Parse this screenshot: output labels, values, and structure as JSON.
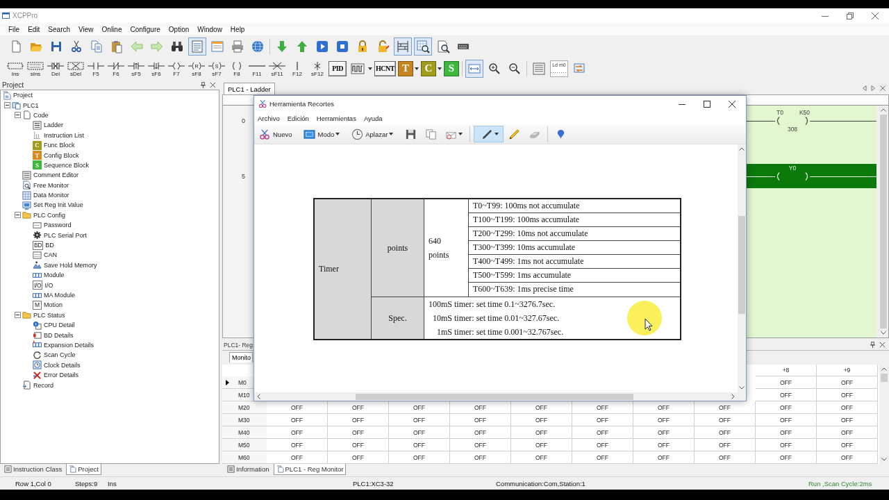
{
  "window": {
    "title": "XCPPro"
  },
  "menu": [
    "File",
    "Edit",
    "Search",
    "View",
    "Online",
    "Configure",
    "Option",
    "Window",
    "Help"
  ],
  "toolbar_main": [
    {
      "kind": "button",
      "pressed": false
    },
    {
      "kind": "button",
      "pressed": false
    },
    {
      "kind": "button",
      "pressed": false
    },
    {
      "kind": "button",
      "pressed": false
    },
    {
      "kind": "button",
      "pressed": false
    },
    {
      "kind": "button",
      "pressed": false
    },
    {
      "kind": "button",
      "pressed": false
    },
    {
      "kind": "button",
      "pressed": false
    },
    {
      "kind": "button",
      "pressed": false
    },
    {
      "kind": "button",
      "pressed": true
    },
    {
      "kind": "button",
      "pressed": false
    },
    {
      "kind": "button",
      "pressed": false
    },
    {
      "kind": "button",
      "pressed": false
    },
    {
      "kind": "separator"
    },
    {
      "kind": "button",
      "pressed": false
    },
    {
      "kind": "button",
      "pressed": false
    },
    {
      "kind": "button",
      "pressed": false
    },
    {
      "kind": "button",
      "pressed": false
    },
    {
      "kind": "button",
      "pressed": false
    },
    {
      "kind": "button",
      "pressed": false
    },
    {
      "kind": "button",
      "pressed": true
    },
    {
      "kind": "button",
      "pressed": true
    },
    {
      "kind": "button",
      "pressed": false
    },
    {
      "kind": "button",
      "pressed": false
    }
  ],
  "toolbar_ladder": [
    {
      "kind": "tool",
      "label": "Ins"
    },
    {
      "kind": "tool",
      "label": "sIns"
    },
    {
      "kind": "tool",
      "label": "Del"
    },
    {
      "kind": "tool",
      "label": "sDel"
    },
    {
      "kind": "tool",
      "label": "F5"
    },
    {
      "kind": "tool",
      "label": "F6"
    },
    {
      "kind": "tool",
      "label": "sF5"
    },
    {
      "kind": "tool",
      "label": "sF6"
    },
    {
      "kind": "tool",
      "label": "F7"
    },
    {
      "kind": "tool",
      "label": "sF8",
      "symbol": "R"
    },
    {
      "kind": "tool",
      "label": "sF7",
      "symbol": "S"
    },
    {
      "kind": "tool",
      "label": "F8"
    },
    {
      "kind": "tool",
      "label": "F11"
    },
    {
      "kind": "tool",
      "label": "sF11"
    },
    {
      "kind": "tool",
      "label": "F12"
    },
    {
      "kind": "tool",
      "label": "sF12"
    },
    {
      "kind": "text",
      "text": "PID"
    },
    {
      "kind": "icon",
      "pressed": false,
      "dropdown": true
    },
    {
      "kind": "text",
      "text": "HCNT"
    },
    {
      "kind": "letter",
      "text": "T",
      "color": "#c8841e",
      "dropdown": true
    },
    {
      "kind": "letter",
      "text": "C",
      "color": "#a19c1c",
      "dropdown": true
    },
    {
      "kind": "letter",
      "text": "S",
      "color": "#3db83d"
    },
    {
      "kind": "separator"
    },
    {
      "kind": "icon",
      "pressed": true
    },
    {
      "kind": "icon",
      "pressed": false
    },
    {
      "kind": "icon",
      "pressed": false
    },
    {
      "kind": "separator"
    },
    {
      "kind": "icon",
      "pressed": false
    },
    {
      "kind": "caption",
      "text": "Ld m0"
    },
    {
      "kind": "icon",
      "pressed": false
    }
  ],
  "project_panel": {
    "title": "Project",
    "tree": [
      {
        "label": "Project",
        "children": [
          {
            "label": "PLC1",
            "expanded": true,
            "children": [
              {
                "label": "Code",
                "expanded": true,
                "children": [
                  {
                    "label": "Ladder"
                  },
                  {
                    "label": "Instruction List"
                  },
                  {
                    "label": "Func Block",
                    "icon_text": "C",
                    "color": "#a19c1c"
                  },
                  {
                    "label": "Config Block",
                    "icon_text": "T",
                    "color": "#d98a1c"
                  },
                  {
                    "label": "Sequence Block",
                    "icon_text": "S",
                    "color": "#3db83d"
                  }
                ]
              },
              {
                "label": "Comment Editor"
              },
              {
                "label": "Free Monitor"
              },
              {
                "label": "Data Monitor"
              },
              {
                "label": "Set Reg Init Value"
              },
              {
                "label": "PLC Config",
                "expanded": true,
                "children": [
                  {
                    "label": "Password"
                  },
                  {
                    "label": "PLC Serial Port"
                  },
                  {
                    "label": "BD",
                    "icon_text": "BD"
                  },
                  {
                    "label": "CAN"
                  },
                  {
                    "label": "Save Hold Memory"
                  },
                  {
                    "label": "Module"
                  },
                  {
                    "label": "I/O",
                    "icon_text": "I/O"
                  },
                  {
                    "label": "MA Module"
                  },
                  {
                    "label": "Motion",
                    "icon_text": "M"
                  }
                ]
              },
              {
                "label": "PLC Status",
                "expanded": true,
                "children": [
                  {
                    "label": "CPU Detail"
                  },
                  {
                    "label": "BD Details"
                  },
                  {
                    "label": "Expansion Details"
                  },
                  {
                    "label": "Scan Cycle"
                  },
                  {
                    "label": "Clock Details"
                  },
                  {
                    "label": "Error Details"
                  }
                ]
              },
              {
                "label": "Record"
              }
            ]
          }
        ]
      }
    ]
  },
  "left_tabs": [
    {
      "label": "Instruction Class",
      "selected": false
    },
    {
      "label": "Project",
      "selected": true
    }
  ],
  "editor": {
    "tab": "PLC1 - Ladder",
    "rungs": [
      {
        "number": "0",
        "energized": false,
        "coil": {
          "name": "T0",
          "preset": "K50",
          "current": "308"
        }
      },
      {
        "number": "5",
        "energized": true,
        "coil": {
          "name": "Y0"
        }
      }
    ]
  },
  "reg_monitor": {
    "title": "PLC1- Reg",
    "tabs": [
      {
        "label": "Monito",
        "selected": true
      }
    ],
    "columns": [
      "+8",
      "+9"
    ],
    "rows": [
      {
        "label": "M0",
        "selected": true,
        "cells": [
          "OFF",
          "OFF"
        ]
      },
      {
        "label": "M10",
        "selected": false,
        "cells": [
          "OFF",
          "OFF"
        ]
      },
      {
        "label": "M20",
        "selected": false,
        "cells": [
          "OFF",
          "OFF",
          "OFF",
          "OFF",
          "OFF",
          "OFF",
          "OFF",
          "OFF",
          "OFF",
          "OFF"
        ]
      },
      {
        "label": "M30",
        "selected": false,
        "cells": [
          "OFF",
          "OFF",
          "OFF",
          "OFF",
          "OFF",
          "OFF",
          "OFF",
          "OFF",
          "OFF",
          "OFF"
        ]
      },
      {
        "label": "M40",
        "selected": false,
        "cells": [
          "OFF",
          "OFF",
          "OFF",
          "OFF",
          "OFF",
          "OFF",
          "OFF",
          "OFF",
          "OFF",
          "OFF"
        ]
      },
      {
        "label": "M50",
        "selected": false,
        "cells": [
          "OFF",
          "OFF",
          "OFF",
          "OFF",
          "OFF",
          "OFF",
          "OFF",
          "OFF",
          "OFF",
          "OFF"
        ]
      },
      {
        "label": "M60",
        "selected": false,
        "cells": [
          "OFF",
          "OFF",
          "OFF",
          "OFF",
          "OFF",
          "OFF",
          "OFF",
          "OFF",
          "OFF",
          "OFF"
        ]
      }
    ]
  },
  "bottom_tabs": [
    {
      "label": "Information",
      "selected": false
    },
    {
      "label": "PLC1 - Reg Monitor",
      "selected": true
    }
  ],
  "status_bar": [
    {
      "text": "Row 1,Col 0",
      "kind": "info"
    },
    {
      "text": "Steps:9",
      "kind": "info"
    },
    {
      "text": "Ins",
      "kind": "info"
    },
    {
      "text": "PLC1:XC3-32",
      "kind": "info"
    },
    {
      "text": "Communication:Com,Station:1",
      "kind": "info"
    },
    {
      "text": "Run ,Scan Cycle:2ms",
      "kind": "run"
    }
  ],
  "snipping_tool": {
    "title": "Herramienta Recortes",
    "menu": [
      "Archivo",
      "Edición",
      "Herramientas",
      "Ayuda"
    ],
    "toolbar": [
      {
        "kind": "labeled",
        "label": "Nuevo",
        "selected": false
      },
      {
        "kind": "labeled",
        "label": "Modo",
        "dropdown": true,
        "selected": false
      },
      {
        "kind": "labeled",
        "label": "Aplazar",
        "dropdown": true,
        "selected": false
      },
      {
        "kind": "icon",
        "selected": false
      },
      {
        "kind": "icon",
        "selected": false
      },
      {
        "kind": "icon",
        "dropdown": true,
        "selected": false
      },
      {
        "kind": "separator"
      },
      {
        "kind": "icon",
        "dropdown": true,
        "selected": true
      },
      {
        "kind": "icon",
        "selected": false
      },
      {
        "kind": "icon",
        "selected": false
      },
      {
        "kind": "separator"
      },
      {
        "kind": "icon",
        "selected": false
      }
    ]
  },
  "document_table": {
    "category": "Timer",
    "points_label": "points",
    "points_value": "640 points",
    "ranges": [
      "T0~T99: 100ms not accumulate",
      "T100~T199: 100ms accumulate",
      "T200~T299: 10ms not accumulate",
      "T300~T399: 10ms accumulate",
      "T400~T499: 1ms not accumulate",
      "T500~T599: 1ms accumulate",
      "T600~T639: 1ms precise time"
    ],
    "spec_label": "Spec.",
    "spec_lines": [
      "100mS timer: set time 0.1~3276.7sec.",
      "10mS timer: set time 0.01~327.67sec.",
      "1mS timer: set time 0.001~32.767sec."
    ]
  }
}
